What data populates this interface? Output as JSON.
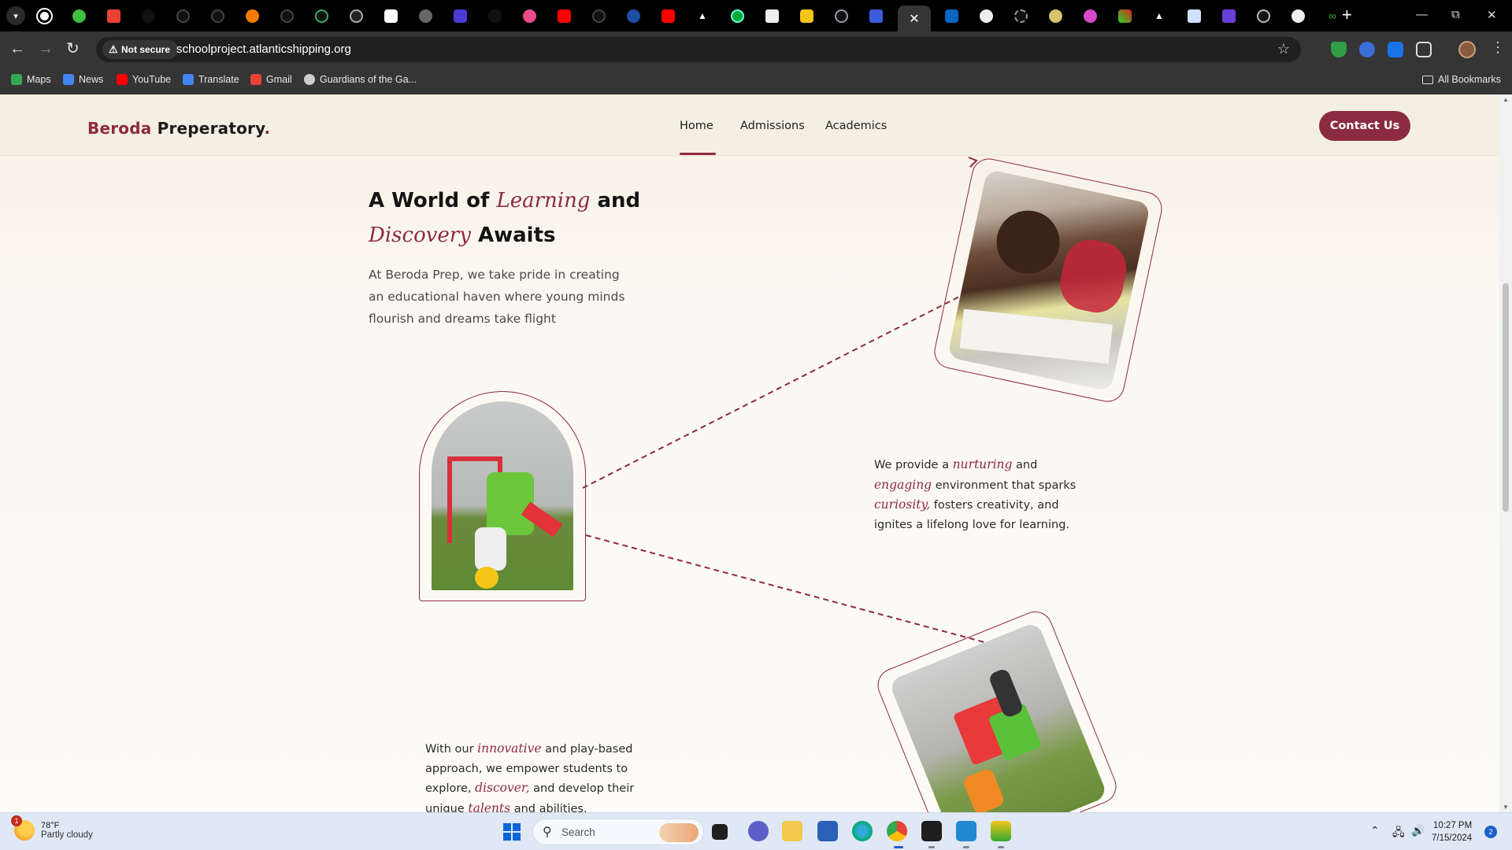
{
  "browser": {
    "address": {
      "security_label": "Not secure",
      "url": "schoolproject.atlanticshipping.org"
    },
    "bookmarks": [
      {
        "label": "Maps",
        "icon": "maps-icon",
        "color": "#34a853"
      },
      {
        "label": "News",
        "icon": "news-icon",
        "color": "#4285f4"
      },
      {
        "label": "YouTube",
        "icon": "youtube-icon",
        "color": "#ff0000"
      },
      {
        "label": "Translate",
        "icon": "translate-icon",
        "color": "#4285f4"
      },
      {
        "label": "Gmail",
        "icon": "gmail-icon",
        "color": "#ea4335"
      },
      {
        "label": "Guardians of the Ga...",
        "icon": "globe-icon",
        "color": "#cccccc"
      }
    ],
    "all_bookmarks_label": "All Bookmarks"
  },
  "site": {
    "logo": {
      "brand": "Beroda",
      "rest": "Preperatory",
      "dot": "."
    },
    "nav": {
      "home": "Home",
      "admissions": "Admissions",
      "academics": "Academics"
    },
    "contact_button": "Contact Us",
    "hero": {
      "title_pre": "A World of ",
      "title_em1": "Learning",
      "title_mid": " and",
      "title_em2": "Discovery",
      "title_post": " Awaits",
      "intro": "At Beroda Prep, we take pride in creating an educational haven where young minds flourish and dreams take flight"
    },
    "para1": {
      "t1": "We provide a ",
      "e1": "nurturing",
      "t2": " and ",
      "e2": "engaging",
      "t3": " environment that sparks ",
      "e3": "curiosity,",
      "t4": " fosters creativity, and ignites a lifelong love for learning."
    },
    "para2": {
      "t1": "With our ",
      "e1": "innovative",
      "t2": " and play-based approach, we empower students to explore, ",
      "e2": "discover,",
      "t3": " and develop their unique ",
      "e3": "talents",
      "t4": " and abilities."
    },
    "accent_color": "#8c2b3f"
  },
  "taskbar": {
    "weather": {
      "temp": "78°F",
      "condition": "Partly cloudy",
      "badge": "1"
    },
    "search_label": "Search",
    "clock": {
      "time": "10:27 PM",
      "date": "7/15/2024"
    },
    "notification_count": "2"
  }
}
